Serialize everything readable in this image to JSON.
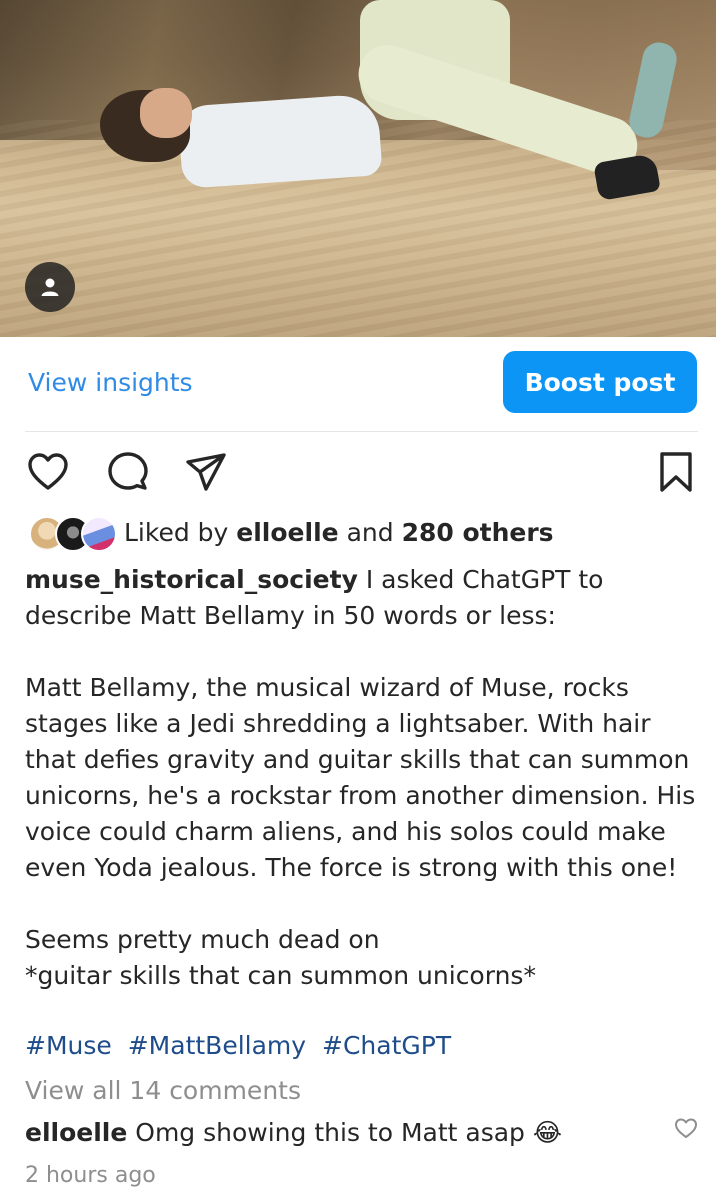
{
  "post": {
    "insights_label": "View insights",
    "boost_label": "Boost post"
  },
  "likes": {
    "prefix": "Liked by",
    "first_user": "elloelle",
    "conjunction": "and",
    "others": "280 others"
  },
  "caption": {
    "username": "muse_historical_society",
    "text": "I asked ChatGPT to describe Matt Bellamy in 50 words or less:\n\nMatt Bellamy, the musical wizard of Muse, rocks stages like a Jedi shredding a lightsaber. With hair that defies gravity and guitar skills that can summon unicorns, he's a rockstar from another dimension. His voice could charm aliens, and his solos could make even Yoda jealous. The force is strong with this one!\n\nSeems pretty much dead on\n*guitar skills that can summon unicorns*",
    "hashtags": [
      "#Muse",
      "#MattBellamy",
      "#ChatGPT"
    ]
  },
  "comments": {
    "view_all": "View all 14 comments",
    "items": [
      {
        "username": "elloelle",
        "text": "Omg showing this to Matt asap 😂"
      }
    ]
  },
  "timestamp": "2 hours ago",
  "colors": {
    "accent": "#0d95f6",
    "link": "#2f8be3",
    "hashtag": "#1f4c8a",
    "muted": "#8e8e8e"
  },
  "icons": [
    "user-tag-icon",
    "heart-icon",
    "comment-icon",
    "share-icon",
    "bookmark-icon",
    "comment-heart-icon"
  ]
}
